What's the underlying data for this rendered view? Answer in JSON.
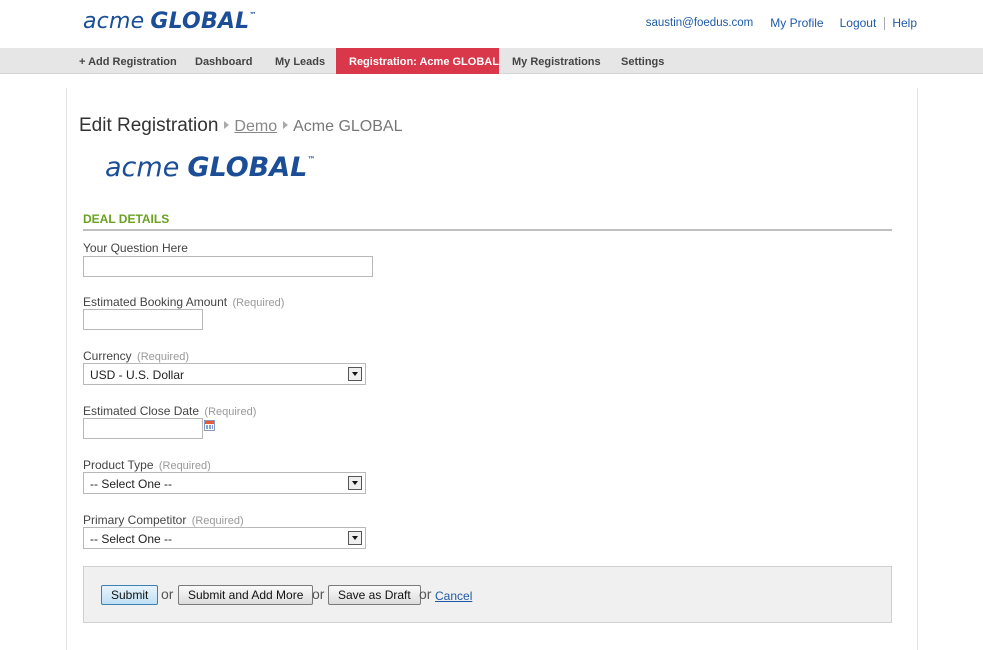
{
  "header": {
    "logo_word1": "acme",
    "logo_word2": "GLOBAL",
    "logo_tm": "™",
    "email": "saustin@foedus.com",
    "my_profile": "My Profile",
    "logout": "Logout",
    "help": "Help"
  },
  "nav": {
    "items": [
      {
        "label": "+ Add Registration"
      },
      {
        "label": "Dashboard"
      },
      {
        "label": "My Leads"
      },
      {
        "label": "Registration: Acme GLOBAL",
        "active": true
      },
      {
        "label": "My Registrations"
      },
      {
        "label": "Settings"
      }
    ]
  },
  "page": {
    "title": "Edit Registration",
    "breadcrumb": [
      "Demo",
      "Acme GLOBAL"
    ]
  },
  "company_logo": {
    "word1": "acme",
    "word2": "GLOBAL",
    "tm": "™"
  },
  "section": {
    "title": "DEAL DETAILS"
  },
  "form": {
    "required_text": "(Required)",
    "fields": [
      {
        "label": "Your Question Here",
        "value": ""
      },
      {
        "label": "Estimated Booking Amount",
        "value": ""
      },
      {
        "label": "Currency",
        "value": "USD - U.S. Dollar"
      },
      {
        "label": "Estimated Close Date",
        "value": ""
      },
      {
        "label": "Product Type",
        "value": "-- Select One --"
      },
      {
        "label": "Primary Competitor",
        "value": "-- Select One --"
      }
    ]
  },
  "actions": {
    "submit": "Submit",
    "submit_add_more": "Submit and Add More",
    "save_draft": "Save as Draft",
    "or": "or",
    "cancel": "Cancel"
  },
  "colors": {
    "brand_blue": "#1b4e96",
    "nav_active": "#d9384b",
    "section_green": "#6aa120"
  },
  "icons": [
    "calendar-icon",
    "chevron-down-icon",
    "breadcrumb-arrow-icon"
  ]
}
